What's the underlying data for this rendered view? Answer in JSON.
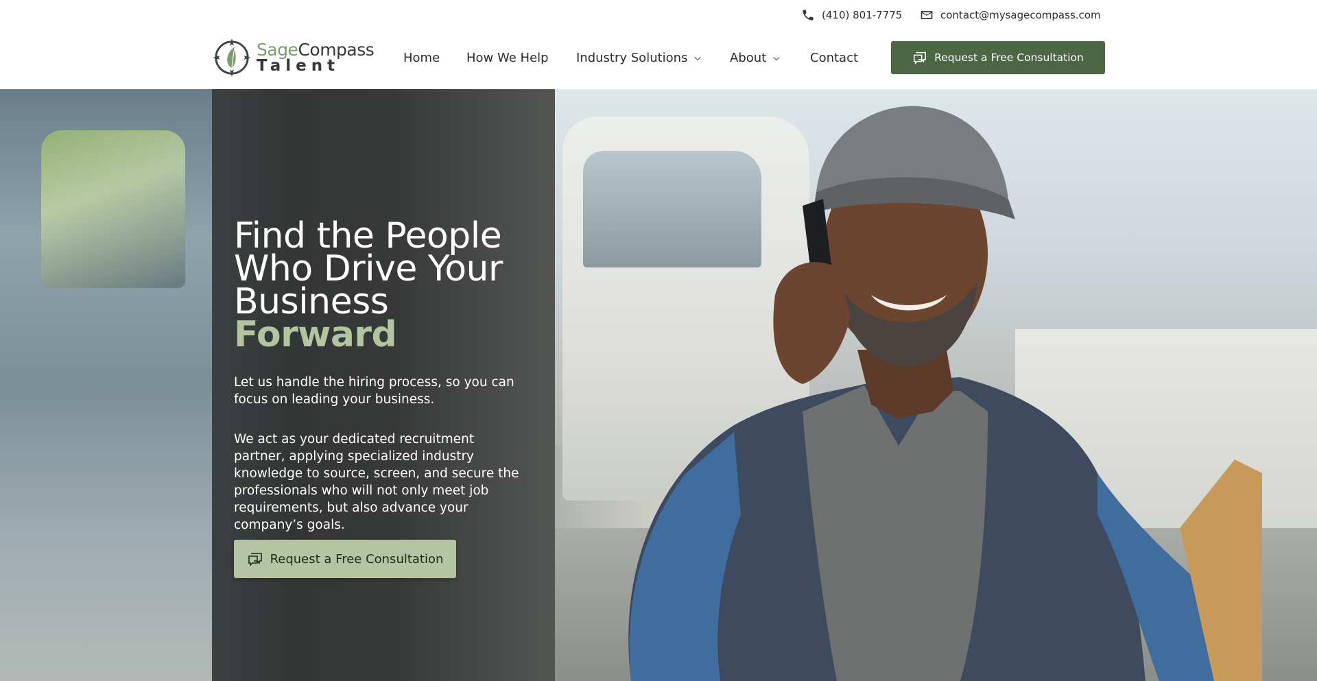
{
  "topbar": {
    "phone": "(410) 801-7775",
    "email": "contact@mysagecompass.com",
    "phone_icon": "phone-icon",
    "email_icon": "mail-icon"
  },
  "brand": {
    "name_part1": "Sage",
    "name_part2": "Compass",
    "name_line2": "Talent",
    "logo_icon": "compass-leaf-logo"
  },
  "nav": {
    "items": [
      {
        "label": "Home"
      },
      {
        "label": "How We Help"
      },
      {
        "label": "Industry Solutions",
        "has_dropdown": true
      },
      {
        "label": "About",
        "has_dropdown": true
      },
      {
        "label": "Contact"
      }
    ],
    "cta_label": "Request a Free Consultation",
    "cta_icon": "chat-bubbles-icon"
  },
  "hero": {
    "heading_main": "Find the People Who Drive Your Business",
    "heading_accent": "Forward",
    "subheading": "Let us handle the hiring process, so you can focus on leading your business.",
    "body": "We act as your dedicated recruitment partner, applying specialized industry knowledge to source, screen, and secure the professionals who will not only meet job requirements, but also advance your company’s goals.",
    "cta_label": "Request a Free Consultation",
    "cta_icon": "chat-bubbles-icon",
    "image_subject": "smiling truck driver on phone in front of trucks"
  },
  "colors": {
    "brand_green": "#4b6744",
    "accent_light_green": "#b4c3a0",
    "hero_button": "#b5c5a3",
    "panel_overlay": "rgba(48,50,48,0.72)"
  }
}
